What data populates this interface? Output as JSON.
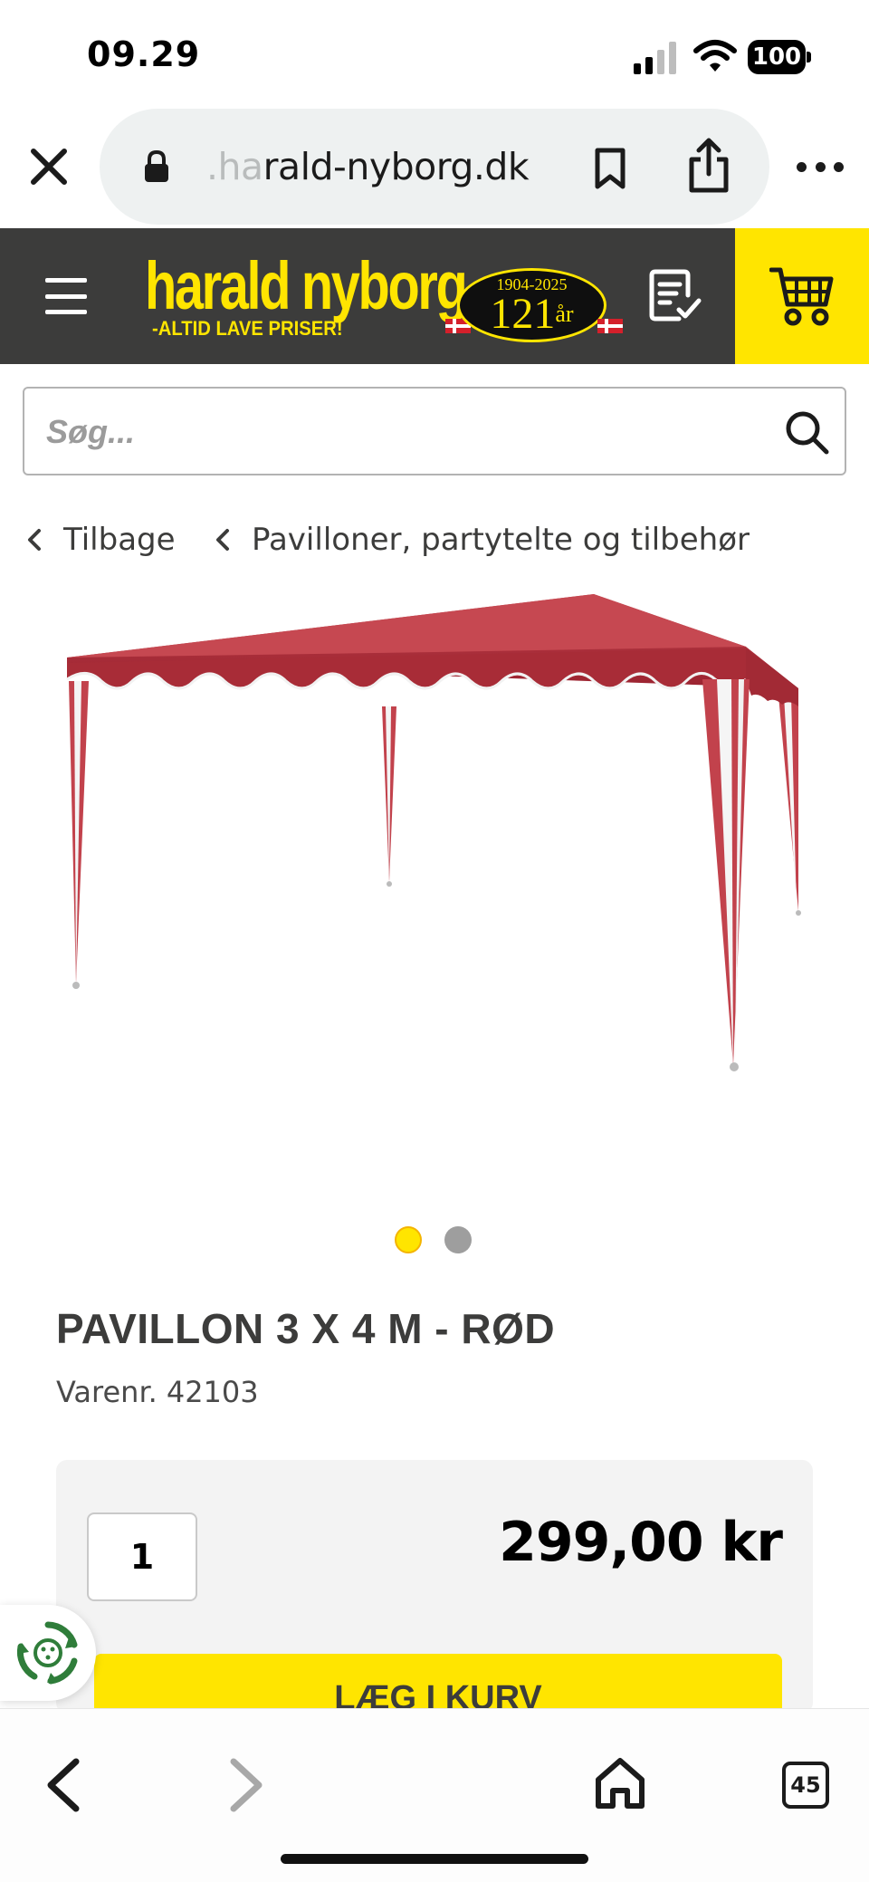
{
  "status_bar": {
    "time": "09.29",
    "battery": "100"
  },
  "browser": {
    "url_faded": ".ha",
    "url_main": "rald-nyborg.dk",
    "tabs_count": "45"
  },
  "header": {
    "logo_name": "harald nyborg",
    "logo_slogan": "-ALTID LAVE PRISER!",
    "badge_years": "1904-2025",
    "badge_count": "121",
    "badge_unit": "år",
    "brand_colors": {
      "dark": "#3c3c3b",
      "yellow": "#ffe500"
    }
  },
  "search": {
    "placeholder": "Søg..."
  },
  "breadcrumb": {
    "back_label": "Tilbage",
    "category_label": "Pavilloner, partytelte og tilbehør"
  },
  "gallery": {
    "image_count": 2,
    "active_index": 1
  },
  "product": {
    "title": "PAVILLON 3 X 4 M - RØD",
    "sku_label": "Varenr.",
    "sku": "42103"
  },
  "purchase": {
    "quantity": "1",
    "price": "299,00 kr",
    "add_to_cart_label": "LÆG I KURV"
  },
  "icons": {
    "close": "close-icon",
    "lock": "lock-icon",
    "bookmark": "bookmark-icon",
    "share": "share-icon",
    "more": "more-icon",
    "menu": "menu-icon",
    "shopping_list": "shopping-list-icon",
    "cart": "cart-icon",
    "search": "search-icon",
    "back": "chevron-left-icon",
    "recycle": "recycle-icon",
    "home": "home-icon"
  }
}
